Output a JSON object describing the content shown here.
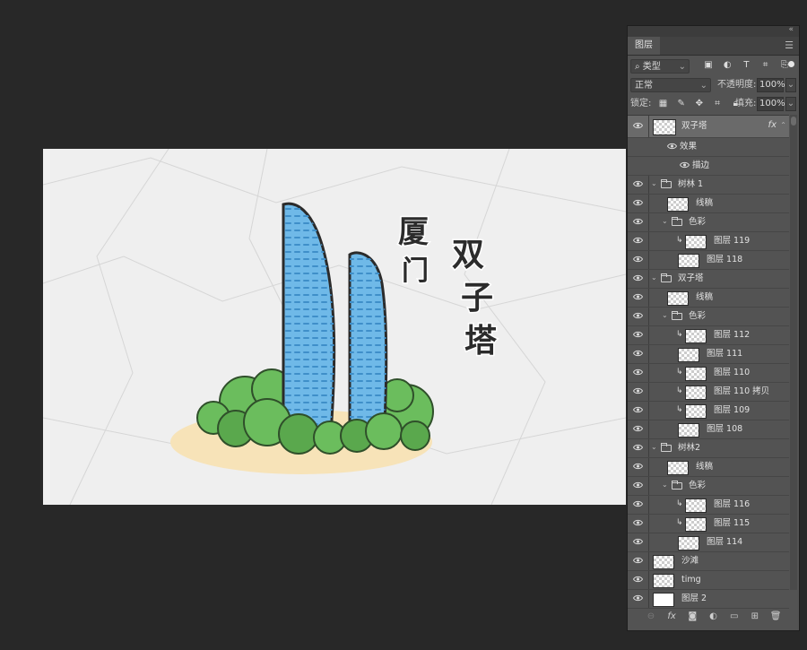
{
  "canvas": {
    "art_title_vertical": [
      "厦",
      "门"
    ],
    "art_title_main": [
      "双",
      "子",
      "塔"
    ],
    "colors": {
      "tower": "#6fb9e8",
      "tower_dark": "#3f8fc9",
      "tree": "#6bbd5d",
      "tree_dark": "#3f7f3a",
      "sand": "#f7e3b8"
    }
  },
  "panel": {
    "collapse_icon": "«",
    "tab": "图层",
    "menu_icon": "menu-lines-icon",
    "filter": {
      "label": "类型",
      "icons": [
        "image-filter-icon",
        "adjustment-filter-icon",
        "type-filter-icon",
        "shape-filter-icon",
        "smartobject-filter-icon"
      ]
    },
    "blend_mode": "正常",
    "opacity_label": "不透明度:",
    "opacity_value": "100%",
    "lock_label": "锁定:",
    "fill_label": "填充:",
    "fill_value": "100%",
    "layers": [
      {
        "name": "双子塔",
        "type": "layer",
        "indent": 0,
        "selected": true,
        "fx": "fx"
      },
      {
        "name": "效果",
        "type": "effect",
        "indent": 1
      },
      {
        "name": "描边",
        "type": "effect",
        "indent": 2
      },
      {
        "name": "树林 1",
        "type": "group",
        "indent": 0
      },
      {
        "name": "线稿",
        "type": "layer",
        "indent": 1
      },
      {
        "name": "色彩",
        "type": "group",
        "indent": 1
      },
      {
        "name": "图层 119",
        "type": "layer",
        "indent": 2,
        "clipped": true
      },
      {
        "name": "图层 118",
        "type": "layer",
        "indent": 2
      },
      {
        "name": "双子塔",
        "type": "group",
        "indent": 0
      },
      {
        "name": "线稿",
        "type": "layer",
        "indent": 1
      },
      {
        "name": "色彩",
        "type": "group",
        "indent": 1
      },
      {
        "name": "图层 112",
        "type": "layer",
        "indent": 2,
        "clipped": true
      },
      {
        "name": "图层 111",
        "type": "layer",
        "indent": 2
      },
      {
        "name": "图层 110",
        "type": "layer",
        "indent": 2,
        "clipped": true
      },
      {
        "name": "图层 110 拷贝",
        "type": "layer",
        "indent": 2,
        "clipped": true
      },
      {
        "name": "图层 109",
        "type": "layer",
        "indent": 2,
        "clipped": true
      },
      {
        "name": "图层 108",
        "type": "layer",
        "indent": 2
      },
      {
        "name": "树林2",
        "type": "group",
        "indent": 0
      },
      {
        "name": "线稿",
        "type": "layer",
        "indent": 1
      },
      {
        "name": "色彩",
        "type": "group",
        "indent": 1
      },
      {
        "name": "图层 116",
        "type": "layer",
        "indent": 2,
        "clipped": true
      },
      {
        "name": "图层 115",
        "type": "layer",
        "indent": 2,
        "clipped": true
      },
      {
        "name": "图层 114",
        "type": "layer",
        "indent": 2
      },
      {
        "name": "沙滩",
        "type": "layer",
        "indent": 0
      },
      {
        "name": "timg",
        "type": "layer",
        "indent": 0,
        "smart": true
      },
      {
        "name": "图层 2",
        "type": "layer",
        "indent": 0,
        "white": true
      }
    ],
    "footer_icons": [
      "link-icon",
      "fx-icon",
      "mask-icon",
      "adjustment-icon",
      "folder-icon",
      "new-layer-icon",
      "trash-icon"
    ]
  }
}
